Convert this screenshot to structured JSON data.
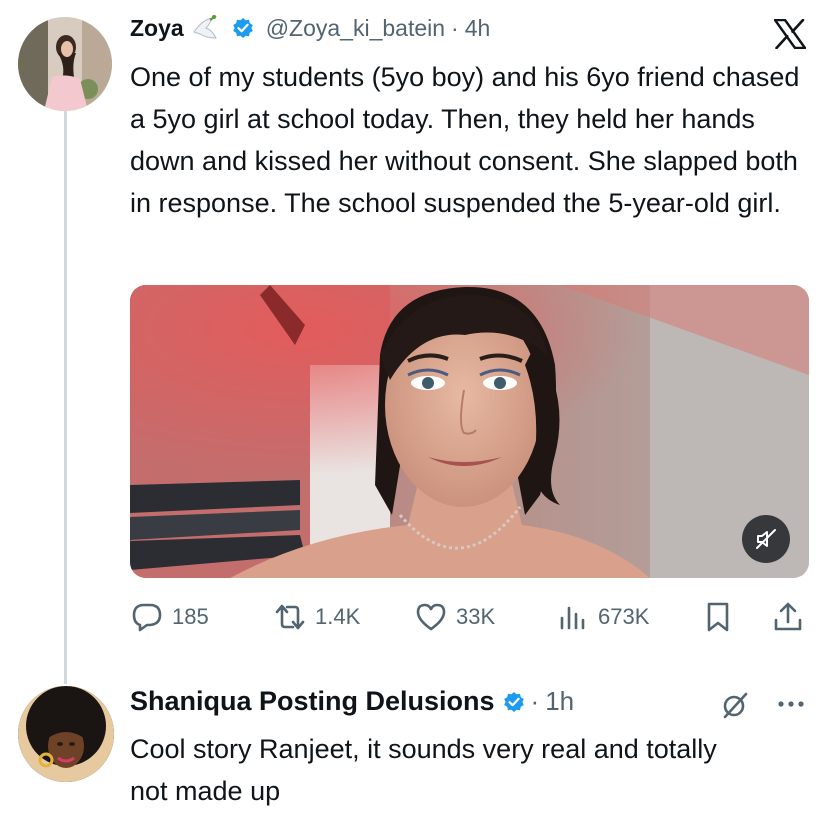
{
  "tweet": {
    "name": "Zoya",
    "handle": "@Zoya_ki_batein",
    "separator": "·",
    "time": "4h",
    "text": "One of my students (5yo boy) and his 6yo friend chased a 5yo girl at school today. Then, they held her hands down and kissed her without consent. She slapped both in response. The school suspended the 5-year-old girl.",
    "metrics": {
      "replies": "185",
      "reposts": "1.4K",
      "likes": "33K",
      "views": "673K"
    }
  },
  "reply": {
    "name": "Shaniqua Posting Delusions",
    "separator": "·",
    "time": "1h",
    "text": "Cool story Ranjeet, it sounds very real and totally not made up"
  },
  "icons": {
    "platform": "x-logo-icon",
    "verified": "verified-badge-icon",
    "dove": "dove-emoji-icon",
    "mute": "volume-muted-icon",
    "reply": "reply-icon",
    "repost": "repost-icon",
    "like": "heart-icon",
    "views": "views-icon",
    "bookmark": "bookmark-icon",
    "share": "share-icon",
    "grok": "grok-icon",
    "more": "more-icon"
  },
  "colors": {
    "verified": "#1d9bf0",
    "text": "#0f1419",
    "secondary": "#536471"
  }
}
